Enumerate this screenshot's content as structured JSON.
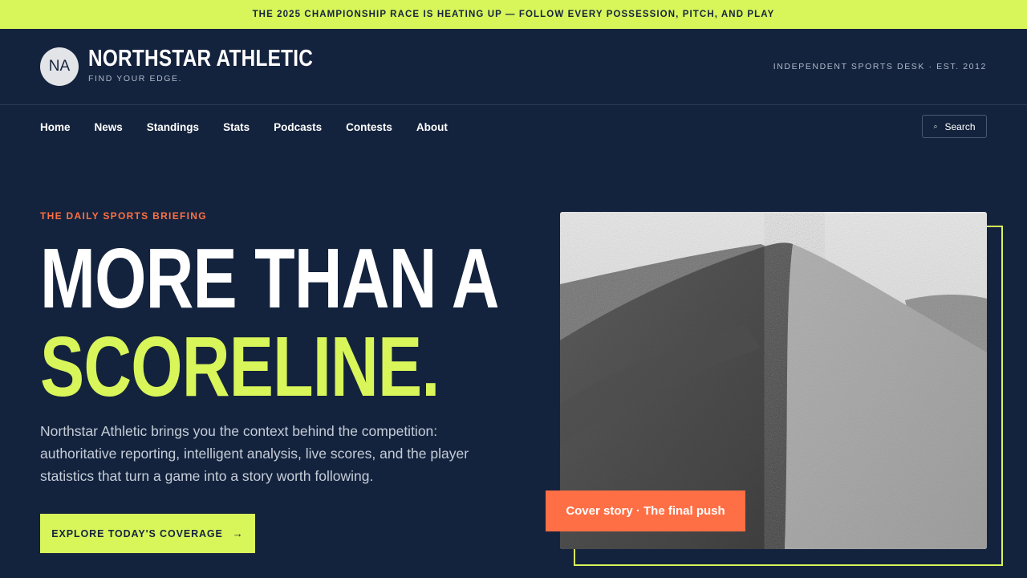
{
  "announcement": "THE 2025 CHAMPIONSHIP RACE IS HEATING UP — FOLLOW EVERY POSSESSION, PITCH, AND PLAY",
  "brand": {
    "initials": "NA",
    "name": "NORTHSTAR ATHLETIC",
    "tagline": "FIND YOUR EDGE.",
    "desk_label": "INDEPENDENT SPORTS DESK · EST. 2012"
  },
  "nav": {
    "items": [
      "Home",
      "News",
      "Standings",
      "Stats",
      "Podcasts",
      "Contests",
      "About"
    ],
    "search_label": "Search",
    "search_icon": "search-icon"
  },
  "hero": {
    "kicker": "THE DAILY SPORTS BRIEFING",
    "headline_line1": "MORE THAN A",
    "headline_line2": "SCORELINE.",
    "intro": "Northstar Athletic brings you the context behind the competition: authoritative reporting, intelligent analysis, live scores, and the player statistics that turn a game into a story worth following.",
    "cta_label": "EXPLORE TODAY'S COVERAGE",
    "cta_arrow": "→",
    "caption": "Cover story · The final push"
  },
  "colors": {
    "background": "#14233d",
    "accent_lime": "#d8f55a",
    "accent_orange": "#ff6f45"
  }
}
